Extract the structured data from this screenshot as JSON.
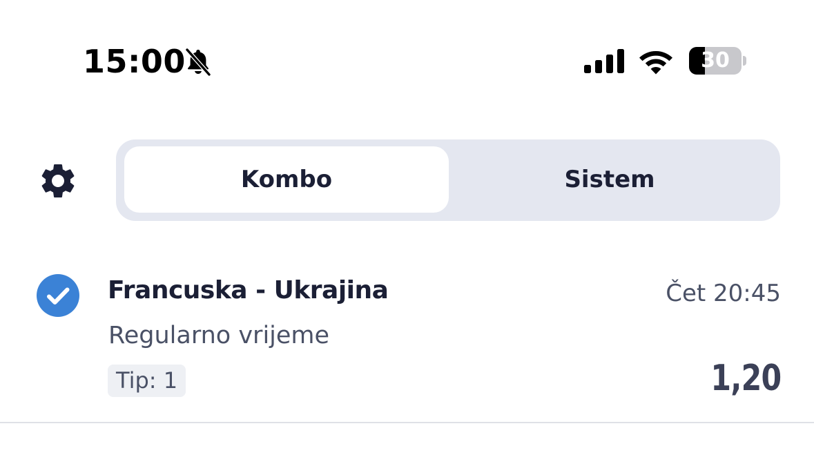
{
  "status_bar": {
    "time": "15:00",
    "icons": [
      "bell-slash-icon",
      "cellular-signal-icon",
      "wifi-icon",
      "battery-icon"
    ],
    "battery_level": "30",
    "battery_fraction": 0.3
  },
  "header": {
    "settings_icon": "gear-icon",
    "tabs": [
      {
        "label": "Kombo",
        "active": true
      },
      {
        "label": "Sistem",
        "active": false
      }
    ]
  },
  "bet": {
    "selected": true,
    "check_icon": "check-circle-icon",
    "match": "Francuska - Ukrajina",
    "time": "Čet 20:45",
    "market": "Regularno vrijeme",
    "tip": "Tip: 1",
    "odds": "1,20"
  },
  "colors": {
    "accent": "#3b82d6",
    "text_primary": "#1b1f35",
    "text_secondary": "#4a5166",
    "segment_bg": "#e4e7f0"
  }
}
